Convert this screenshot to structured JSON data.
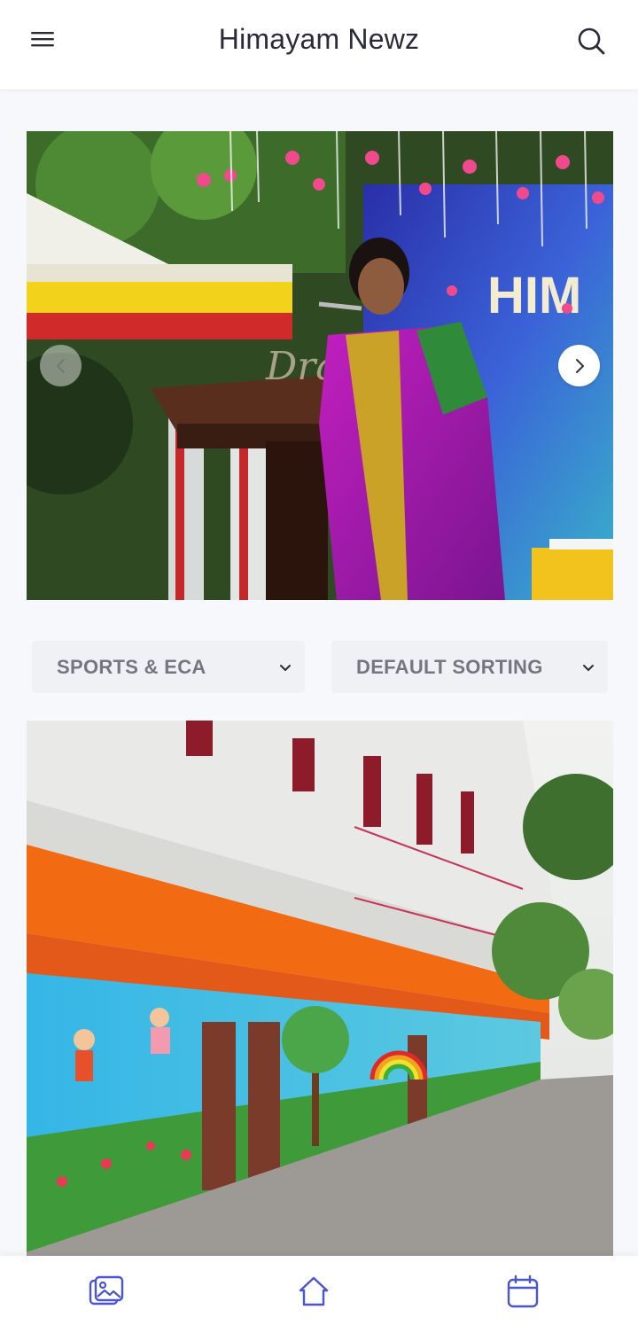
{
  "header": {
    "title": "Himayam Newz",
    "menu_icon": "hamburger-menu-icon",
    "search_icon": "search-icon"
  },
  "hero_slider": {
    "prev_icon": "chevron-left-icon",
    "next_icon": "chevron-right-icon",
    "image_subject": "Woman speaking at a podium during a school event"
  },
  "filters": {
    "category": {
      "selected": "SPORTS & ECA",
      "icon": "chevron-down-icon"
    },
    "sorting": {
      "selected": "DEFAULT SORTING",
      "icon": "chevron-down-icon"
    }
  },
  "post": {
    "image_subject": "School building with colorful painted mural wall"
  },
  "bottom_nav": {
    "items": [
      {
        "icon": "gallery-icon"
      },
      {
        "icon": "home-icon"
      },
      {
        "icon": "calendar-icon"
      }
    ]
  },
  "colors": {
    "accent": "#4a55d6",
    "title_text": "#2a2a3a",
    "select_bg": "#f0f1f5",
    "select_text": "#757681"
  }
}
